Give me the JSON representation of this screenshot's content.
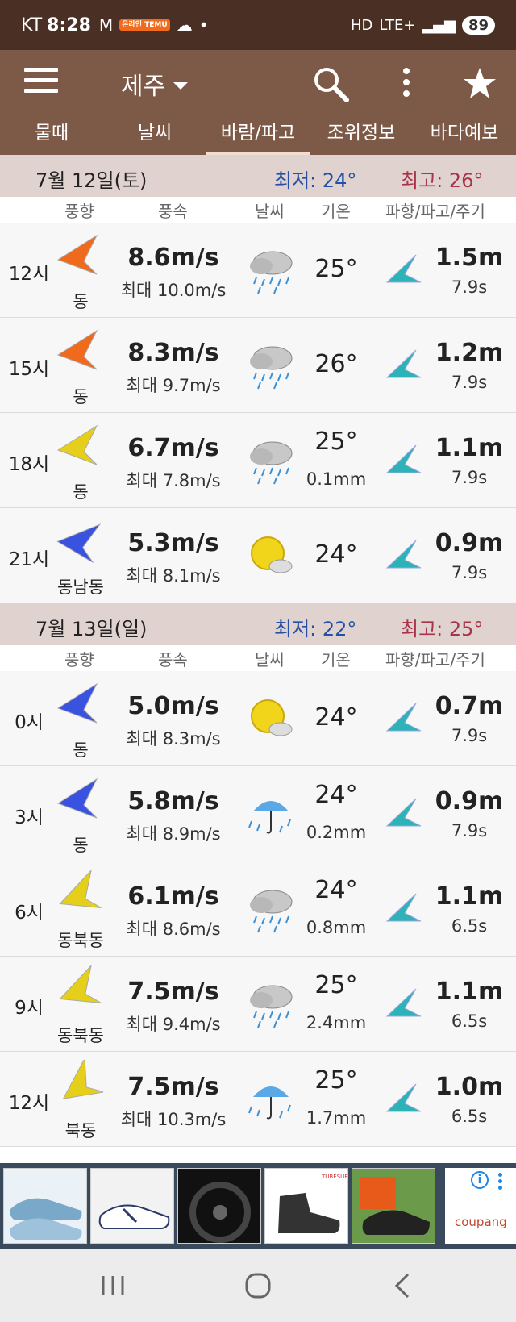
{
  "status_bar": {
    "carrier": "KT",
    "time": "8:28",
    "mail_icon": "M",
    "temu_badge": "온라인 TEMU",
    "battery": "89",
    "network": "LTE+"
  },
  "header": {
    "location": "제주"
  },
  "tabs": [
    "물때",
    "날씨",
    "바람/파고",
    "조위정보",
    "바다예보"
  ],
  "active_tab": 2,
  "columns": {
    "wind_dir": "풍향",
    "wind_speed": "풍속",
    "weather": "날씨",
    "temp": "기온",
    "wave": "파향/파고/주기"
  },
  "days": [
    {
      "date": "7월 12일(토)",
      "low": "최저: 24°",
      "high": "최고: 26°",
      "rows": [
        {
          "time": "12시",
          "dir": "동",
          "speed": "8.6m/s",
          "max": "최대 10.0m/s",
          "icon": "rain-cloud-icon",
          "temp": "25°",
          "precip": "",
          "wave_height": "1.5m",
          "wave_period": "7.9s",
          "arrow_color": "#f06a1e"
        },
        {
          "time": "15시",
          "dir": "동",
          "speed": "8.3m/s",
          "max": "최대 9.7m/s",
          "icon": "rain-cloud-icon",
          "temp": "26°",
          "precip": "",
          "wave_height": "1.2m",
          "wave_period": "7.9s",
          "arrow_color": "#f06a1e"
        },
        {
          "time": "18시",
          "dir": "동",
          "speed": "6.7m/s",
          "max": "최대 7.8m/s",
          "icon": "rain-cloud-icon",
          "temp": "25°",
          "precip": "0.1mm",
          "wave_height": "1.1m",
          "wave_period": "7.9s",
          "arrow_color": "#e6cf1a"
        },
        {
          "time": "21시",
          "dir": "동남동",
          "speed": "5.3m/s",
          "max": "최대 8.1m/s",
          "icon": "sun-cloud-icon",
          "temp": "24°",
          "precip": "",
          "wave_height": "0.9m",
          "wave_period": "7.9s",
          "arrow_color": "#3a52e0"
        }
      ]
    },
    {
      "date": "7월 13일(일)",
      "low": "최저: 22°",
      "high": "최고: 25°",
      "rows": [
        {
          "time": "0시",
          "dir": "동",
          "speed": "5.0m/s",
          "max": "최대 8.3m/s",
          "icon": "sun-cloud-icon",
          "temp": "24°",
          "precip": "",
          "wave_height": "0.7m",
          "wave_period": "7.9s",
          "arrow_color": "#3a52e0"
        },
        {
          "time": "3시",
          "dir": "동",
          "speed": "5.8m/s",
          "max": "최대 8.9m/s",
          "icon": "umbrella-rain-icon",
          "temp": "24°",
          "precip": "0.2mm",
          "wave_height": "0.9m",
          "wave_period": "7.9s",
          "arrow_color": "#3a52e0"
        },
        {
          "time": "6시",
          "dir": "동북동",
          "speed": "6.1m/s",
          "max": "최대 8.6m/s",
          "icon": "rain-cloud-icon",
          "temp": "24°",
          "precip": "0.8mm",
          "wave_height": "1.1m",
          "wave_period": "6.5s",
          "arrow_color": "#e6cf1a"
        },
        {
          "time": "9시",
          "dir": "동북동",
          "speed": "7.5m/s",
          "max": "최대 9.4m/s",
          "icon": "rain-cloud-icon",
          "temp": "25°",
          "precip": "2.4mm",
          "wave_height": "1.1m",
          "wave_period": "6.5s",
          "arrow_color": "#e6cf1a"
        },
        {
          "time": "12시",
          "dir": "북동",
          "speed": "7.5m/s",
          "max": "최대 10.3m/s",
          "icon": "umbrella-rain-icon",
          "temp": "25°",
          "precip": "1.7mm",
          "wave_height": "1.0m",
          "wave_period": "6.5s",
          "arrow_color": "#e6cf1a"
        }
      ]
    }
  ],
  "ad": {
    "brand": "coupang",
    "small_logo": "TUBESURE"
  },
  "colors": {
    "appbar": "#7d5a48",
    "statusbar": "#4a3024",
    "dayhead": "#e0d2cf",
    "low": "#2550a6",
    "high": "#a8344a",
    "wave_arrow": "#2bb3b8"
  }
}
